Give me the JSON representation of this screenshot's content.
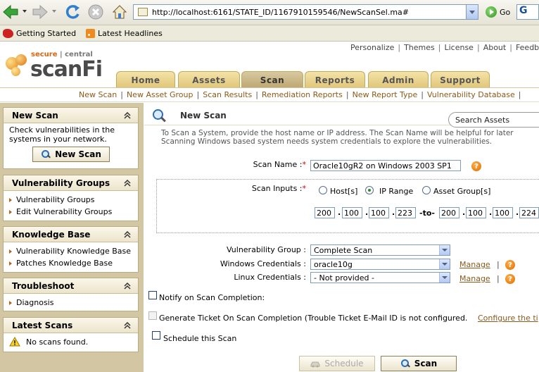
{
  "browser": {
    "url": "http://localhost:6161/STATE_ID/1167910159546/NewScanSel.ma#",
    "go_label": "Go",
    "bookmarks": [
      "Getting Started",
      "Latest Headlines"
    ]
  },
  "header": {
    "logo_tag_a": "secure",
    "logo_tag_b": "central",
    "logo_name": "scanFi",
    "top_links": [
      "Personalize",
      "Themes",
      "License",
      "About",
      "Feedback"
    ],
    "tabs": [
      "Home",
      "Assets",
      "Scan",
      "Reports",
      "Admin",
      "Support"
    ],
    "active_tab": "Scan"
  },
  "subnav": [
    "New Scan",
    "New Asset Group",
    "Scan Results",
    "Remediation Reports",
    "New Report Type",
    "Vulnerability Database"
  ],
  "sidebar": {
    "new_scan": {
      "title": "New Scan",
      "text": "Check vulnerabilities in the systems in your network.",
      "button": "New Scan"
    },
    "vuln_groups": {
      "title": "Vulnerability Groups",
      "items": [
        "Vulnerability Groups",
        "Edit Vulnerability Groups"
      ]
    },
    "knowledge_base": {
      "title": "Knowledge Base",
      "items": [
        "Vulnerability Knowledge Base",
        "Patches Knowledge Base"
      ]
    },
    "troubleshoot": {
      "title": "Troubleshoot",
      "items": [
        "Diagnosis"
      ]
    },
    "latest_scans": {
      "title": "Latest Scans",
      "text": "No scans found."
    }
  },
  "main": {
    "title": "New Scan",
    "search_placeholder": "Search Assets",
    "intro_line1": "To Scan a System, provide the host name or IP address. The Scan Name will be helpful for later",
    "intro_line2": "Scanning Windows based system needs system credentials to explore the vulnerabilities.",
    "scan_name_label": "Scan Name :",
    "scan_name_value": "Oracle10gR2 on Windows 2003 SP1",
    "scan_inputs_label": "Scan Inputs :",
    "radio_hosts": "Host[s]",
    "radio_ip": "IP Range",
    "radio_group": "Asset Group[s]",
    "ip_from": [
      "200",
      "100",
      "100",
      "223"
    ],
    "ip_to": [
      "200",
      "100",
      "100",
      "224"
    ],
    "to_label": "-to-",
    "vuln_group_label": "Vulnerability Group :",
    "vuln_group_value": "Complete Scan",
    "win_cred_label": "Windows Credentials :",
    "win_cred_value": "oracle10g",
    "linux_cred_label": "Linux Credentials :",
    "linux_cred_value": "- Not provided -",
    "manage": "Manage",
    "notify_label": "Notify on Scan Completion:",
    "ticket_label": "Generate Ticket On Scan Completion (Trouble Ticket E-Mail ID is not configured.",
    "ticket_link": "Configure the ti",
    "schedule_label": "Schedule this Scan",
    "schedule_button": "Schedule",
    "scan_button": "Scan"
  }
}
